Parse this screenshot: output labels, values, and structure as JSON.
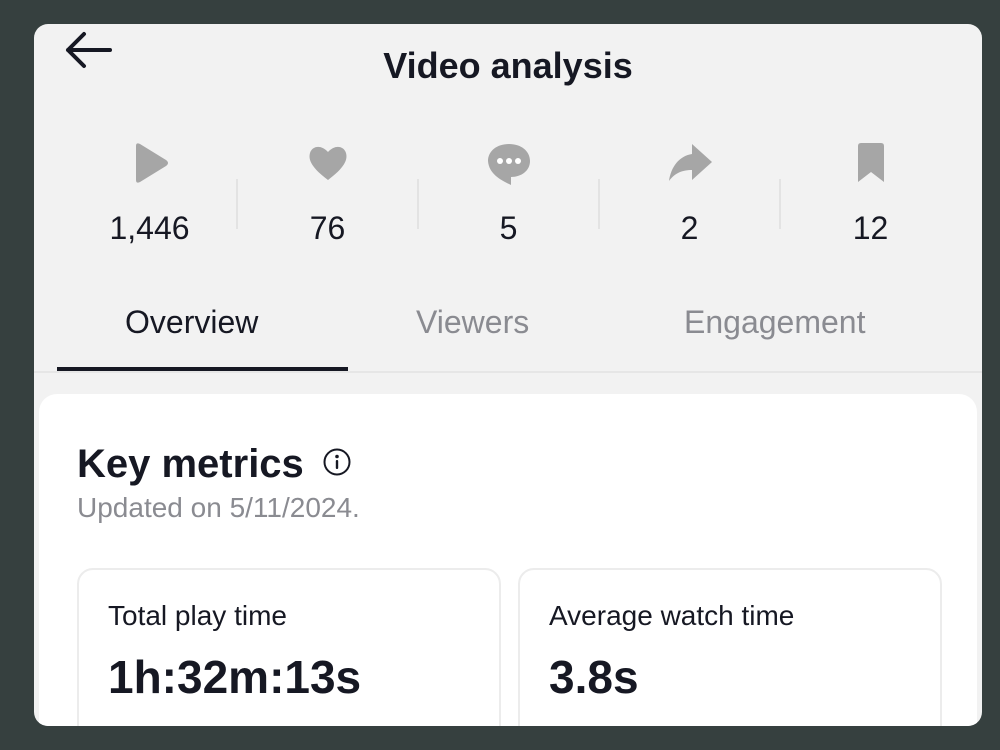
{
  "header": {
    "title": "Video analysis",
    "back_icon": "arrow-left-icon"
  },
  "stats": [
    {
      "icon": "play-icon",
      "value": "1,446"
    },
    {
      "icon": "heart-icon",
      "value": "76"
    },
    {
      "icon": "comment-icon",
      "value": "5"
    },
    {
      "icon": "share-icon",
      "value": "2"
    },
    {
      "icon": "bookmark-icon",
      "value": "12"
    }
  ],
  "tabs": [
    {
      "label": "Overview",
      "active": true
    },
    {
      "label": "Viewers",
      "active": false
    },
    {
      "label": "Engagement",
      "active": false
    }
  ],
  "key_metrics": {
    "title": "Key metrics",
    "info_icon": "info-icon",
    "updated": "Updated on 5/11/2024.",
    "cards": [
      {
        "label": "Total play time",
        "value": "1h:32m:13s"
      },
      {
        "label": "Average watch time",
        "value": "3.8s"
      }
    ]
  },
  "colors": {
    "background": "#36403f",
    "surface": "#f2f2f2",
    "card": "#ffffff",
    "text_primary": "#161823",
    "text_secondary": "#8a8b91",
    "icon_gray": "#a6a6a6"
  }
}
